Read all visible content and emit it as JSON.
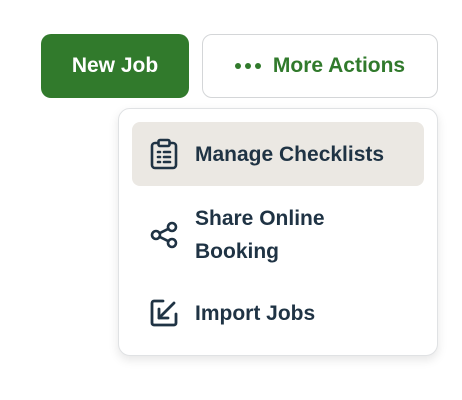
{
  "toolbar": {
    "new_job_label": "New Job",
    "more_actions_label": "More Actions"
  },
  "menu": {
    "items": [
      {
        "label": "Manage Checklists",
        "icon": "clipboard-checklist-icon",
        "active": true
      },
      {
        "label": "Share Online Booking",
        "icon": "share-icon",
        "active": false
      },
      {
        "label": "Import Jobs",
        "icon": "import-arrow-icon",
        "active": false
      }
    ]
  },
  "colors": {
    "primary_green": "#317a2c",
    "menu_text": "#1f3344",
    "active_item_bg": "#ebe8e3"
  }
}
